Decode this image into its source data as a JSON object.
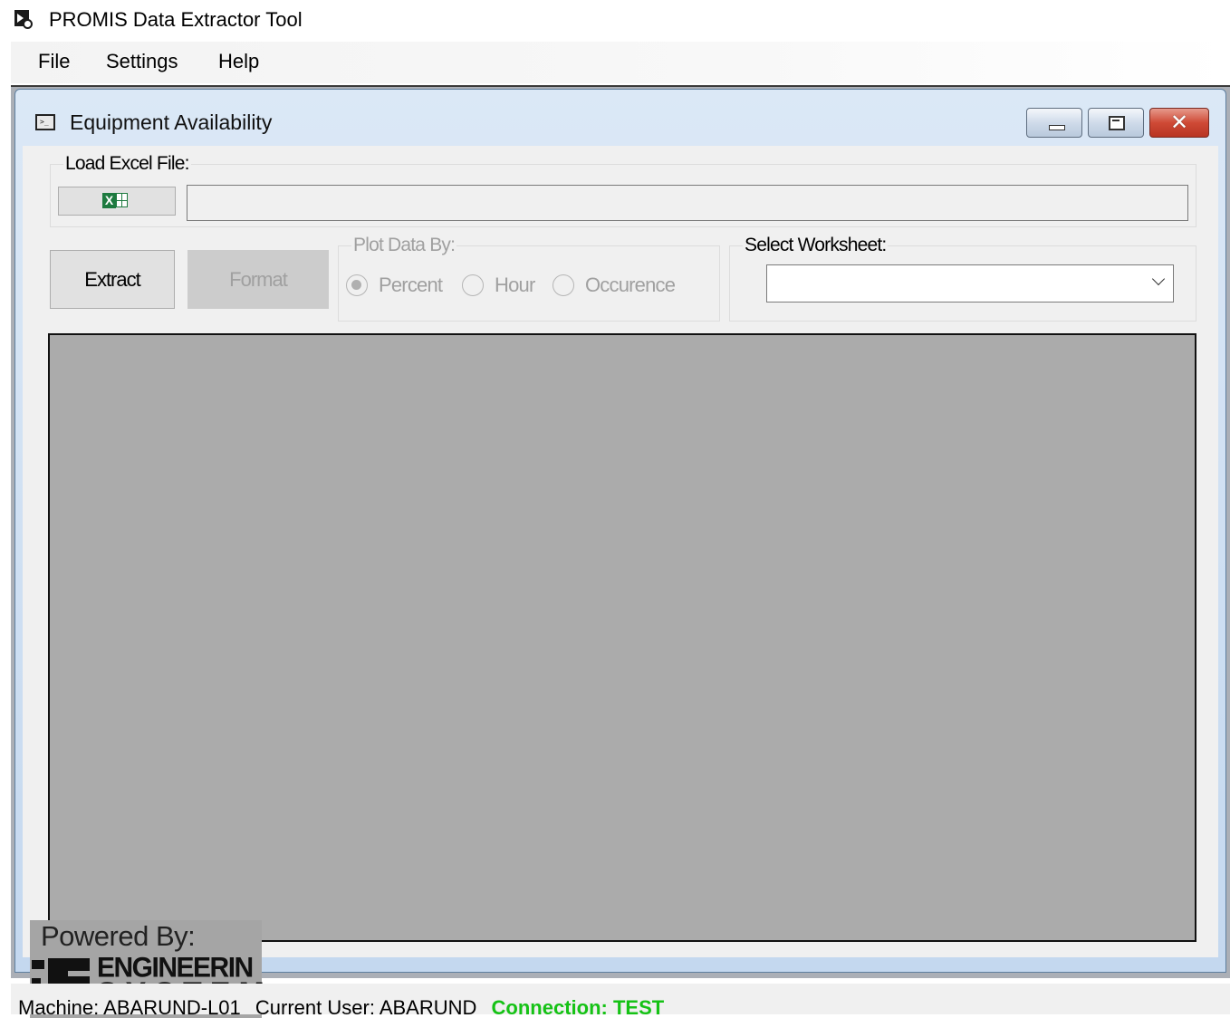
{
  "app": {
    "title": "PROMIS Data Extractor Tool"
  },
  "menu": {
    "items": [
      "File",
      "Settings",
      "Help"
    ]
  },
  "child_window": {
    "title": "Equipment Availability"
  },
  "load_excel": {
    "group_label": "Load Excel File:",
    "file_path": ""
  },
  "actions": {
    "extract_label": "Extract",
    "format_label": "Format"
  },
  "plot_by": {
    "group_label": "Plot Data By:",
    "options": [
      "Percent",
      "Hour",
      "Occurence"
    ],
    "selected": "Percent"
  },
  "worksheet": {
    "group_label": "Select Worksheet:",
    "selected": ""
  },
  "branding": {
    "powered_by": "Powered By:",
    "logo_line1": "ENGINEERIN",
    "logo_line2": "SYSTEM"
  },
  "status": {
    "machine": "Machine: ABARUND-L01",
    "user": "Current User: ABARUND",
    "connection": "Connection: TEST"
  },
  "colors": {
    "connection_text": "#15c215",
    "plot_area": "#ababab",
    "excel_green": "#1d7a3f"
  }
}
